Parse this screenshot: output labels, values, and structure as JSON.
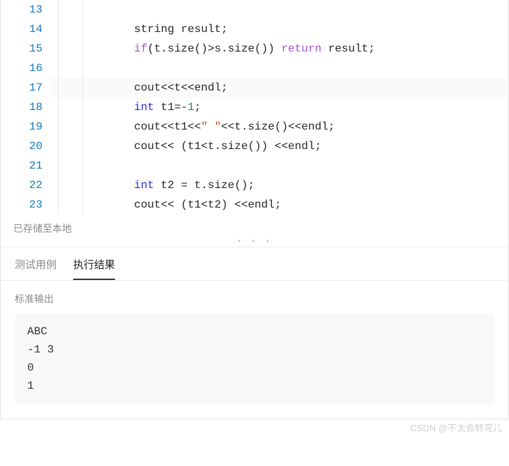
{
  "editor": {
    "lines": [
      {
        "num": 13,
        "tokens": []
      },
      {
        "num": 14,
        "tokens": [
          {
            "t": "            string result;",
            "c": "id"
          }
        ]
      },
      {
        "num": 15,
        "tokens": [
          {
            "t": "            ",
            "c": "id"
          },
          {
            "t": "if",
            "c": "kw2"
          },
          {
            "t": "(t.size()>s.size()) ",
            "c": "id"
          },
          {
            "t": "return",
            "c": "kw2"
          },
          {
            "t": " result;",
            "c": "id"
          }
        ]
      },
      {
        "num": 16,
        "tokens": []
      },
      {
        "num": 17,
        "hl": true,
        "tokens": [
          {
            "t": "            cout<<t<<endl;",
            "c": "id"
          }
        ]
      },
      {
        "num": 18,
        "tokens": [
          {
            "t": "            ",
            "c": "id"
          },
          {
            "t": "int",
            "c": "kw"
          },
          {
            "t": " t1=-",
            "c": "id"
          },
          {
            "t": "1",
            "c": "num"
          },
          {
            "t": ";",
            "c": "id"
          }
        ]
      },
      {
        "num": 19,
        "tokens": [
          {
            "t": "            cout<<t1<<",
            "c": "id"
          },
          {
            "t": "\" \"",
            "c": "str"
          },
          {
            "t": "<<t.size()<<endl;",
            "c": "id"
          }
        ]
      },
      {
        "num": 20,
        "tokens": [
          {
            "t": "            cout<< (t1<t.size()) <<endl;",
            "c": "id"
          }
        ]
      },
      {
        "num": 21,
        "tokens": []
      },
      {
        "num": 22,
        "tokens": [
          {
            "t": "            ",
            "c": "id"
          },
          {
            "t": "int",
            "c": "kw"
          },
          {
            "t": " t2 = t.size();",
            "c": "id"
          }
        ]
      },
      {
        "num": 23,
        "tokens": [
          {
            "t": "            cout<< (t1<t2) <<endl;",
            "c": "id"
          }
        ]
      }
    ]
  },
  "status": {
    "saved": "已存储至本地"
  },
  "tabs": {
    "testcase": "测试用例",
    "result": "执行结果"
  },
  "output": {
    "label": "标准输出",
    "lines": [
      "ABC",
      "-1 3",
      "0",
      "1"
    ]
  },
  "watermark": "CSDN @不太会转弯儿"
}
